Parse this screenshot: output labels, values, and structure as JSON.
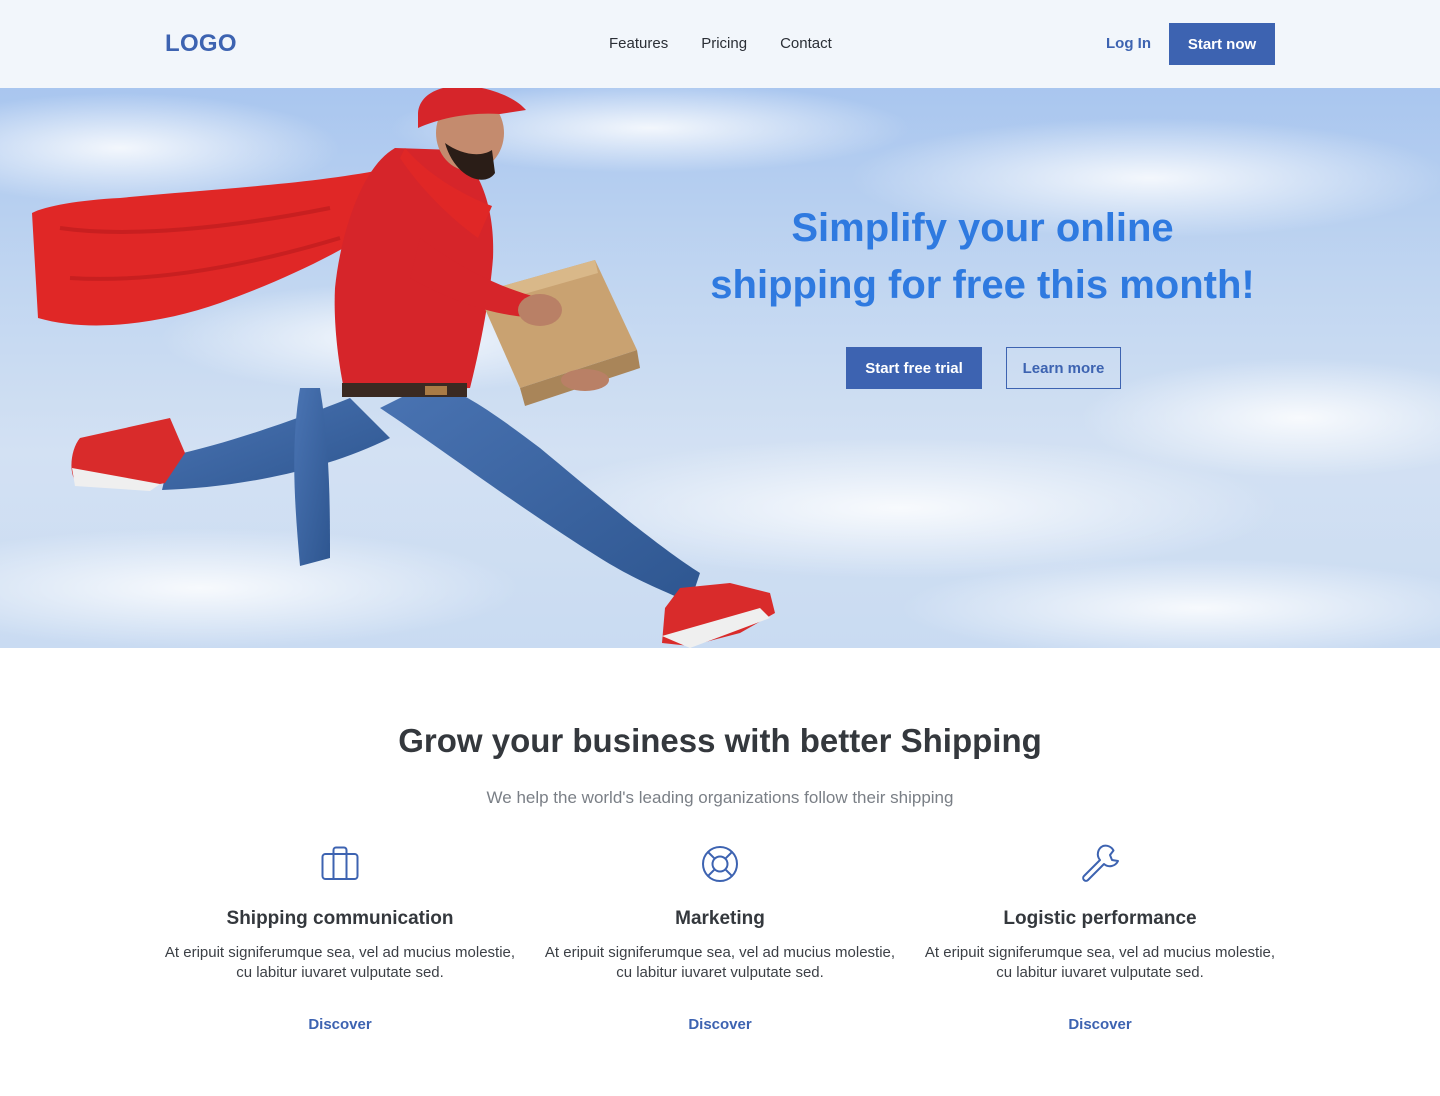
{
  "header": {
    "logo": "LOGO",
    "nav": [
      "Features",
      "Pricing",
      "Contact"
    ],
    "login_label": "Log In",
    "cta_label": "Start now"
  },
  "hero": {
    "title_line1": "Simplify your online",
    "title_line2": "shipping for free this month!",
    "primary_label": "Start free trial",
    "secondary_label": "Learn more"
  },
  "features_section": {
    "title": "Grow your business with better Shipping",
    "subtitle": "We help the world's leading organizations follow their shipping",
    "items": [
      {
        "icon": "briefcase-icon",
        "title": "Shipping communication",
        "desc_line1": "At eripuit signiferumque sea, vel ad mucius molestie,",
        "desc_line2": "cu labitur iuvaret vulputate sed.",
        "link": "Discover"
      },
      {
        "icon": "life-buoy-icon",
        "title": "Marketing",
        "desc_line1": "At eripuit signiferumque sea, vel ad mucius molestie,",
        "desc_line2": "cu labitur iuvaret vulputate sed.",
        "link": "Discover"
      },
      {
        "icon": "wrench-icon",
        "title": "Logistic performance",
        "desc_line1": "At eripuit signiferumque sea, vel ad mucius molestie,",
        "desc_line2": "cu labitur iuvaret vulputate sed.",
        "link": "Discover"
      }
    ]
  },
  "colors": {
    "brand": "#3d63b1",
    "hero_title": "#2f7ae0",
    "header_bg": "#f2f6fb"
  }
}
